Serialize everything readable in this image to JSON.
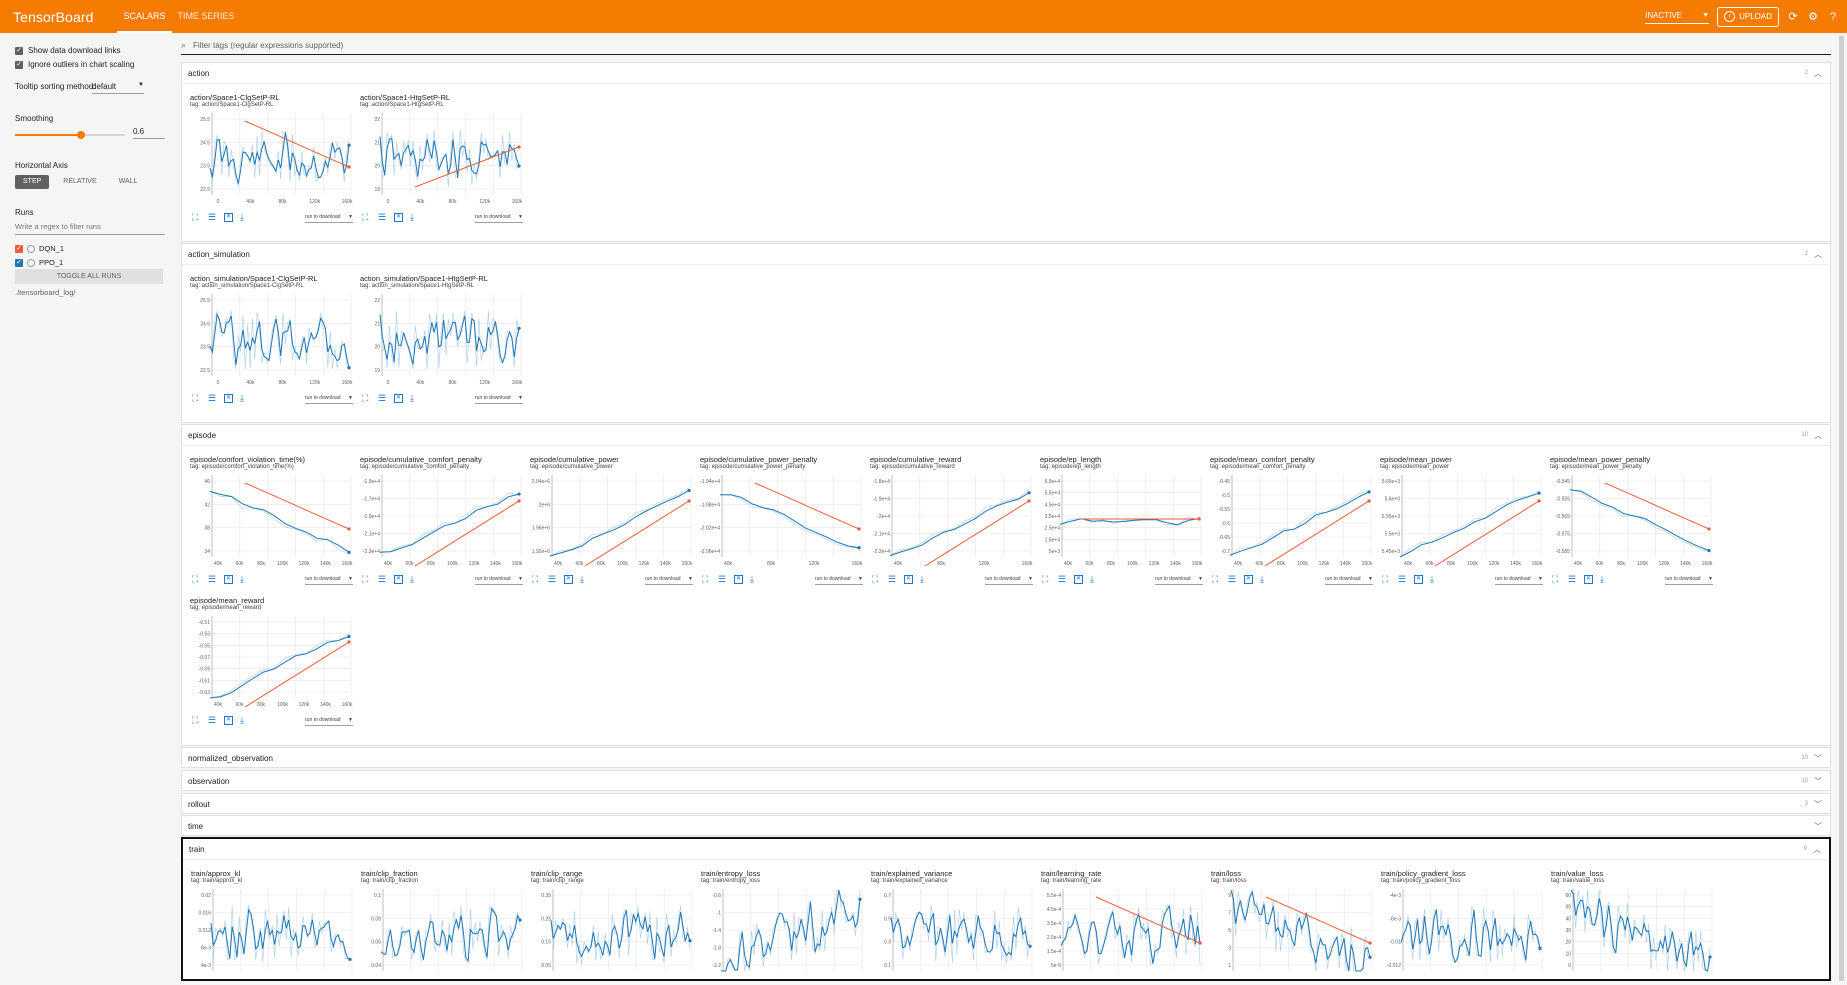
{
  "header": {
    "brand": "TensorBoard",
    "tabs": [
      {
        "label": "SCALARS",
        "active": true
      },
      {
        "label": "TIME SERIES",
        "active": false
      }
    ],
    "status_select": "INACTIVE",
    "upload_label": "UPLOAD"
  },
  "sidebar": {
    "show_download_links": "Show data download links",
    "ignore_outliers": "Ignore outliers in chart scaling",
    "tooltip_label": "Tooltip sorting method:",
    "tooltip_value": "default",
    "smoothing_label": "Smoothing",
    "smoothing_value": "0.6",
    "smoothing_fraction": 0.6,
    "horizontal_axis_label": "Horizontal Axis",
    "axis_options": [
      "STEP",
      "RELATIVE",
      "WALL"
    ],
    "runs_label": "Runs",
    "runs_filter_placeholder": "Write a regex to filter runs",
    "runs": [
      {
        "name": "DQN_1",
        "color": "#ef5b3a"
      },
      {
        "name": "PPO_1",
        "color": "#1f77b4"
      }
    ],
    "toggle_all_label": "TOGGLE ALL RUNS",
    "log_path": "./tensorboard_log/"
  },
  "main": {
    "filter_placeholder": "Filter tags (regular expressions supported)",
    "download_select": "run to download",
    "sections": [
      {
        "title": "action",
        "count": "2"
      },
      {
        "title": "action_simulation",
        "count": "2"
      },
      {
        "title": "episode",
        "count": "10"
      },
      {
        "title": "normalized_observation",
        "count": "10"
      },
      {
        "title": "observation",
        "count": "10"
      },
      {
        "title": "rollout",
        "count": "3"
      },
      {
        "title": "time",
        "count": ""
      },
      {
        "title": "train",
        "count": "9"
      }
    ],
    "cards": [
      {
        "title": "action/Space1-ClgSetP-RL",
        "tag": "tag: action/Space1-ClgSetP-RL",
        "yticks": [
          "25.5",
          "24.5",
          "23.5",
          "22.5"
        ],
        "xticks": [
          "0",
          "40k",
          "80k",
          "120k",
          "160k"
        ]
      },
      {
        "title": "action/Space1-HtgSetP-RL",
        "tag": "tag: action/Space1-HtgSetP-RL",
        "yticks": [
          "22",
          "21",
          "20",
          "19"
        ],
        "xticks": [
          "0",
          "40k",
          "80k",
          "120k",
          "160k"
        ]
      },
      {
        "title": "action_simulation/Space1-ClgSetP-RL",
        "tag": "tag: action_simulation/Space1-ClgSetP-RL",
        "yticks": [
          "25.5",
          "24.5",
          "23.5",
          "22.5"
        ],
        "xticks": [
          "0",
          "40k",
          "80k",
          "120k",
          "160k"
        ]
      },
      {
        "title": "action_simulation/Space1-HtgSetP-RL",
        "tag": "tag: action_simulation/Space1-HtgSetP-RL",
        "yticks": [
          "22",
          "21",
          "20",
          "19"
        ],
        "xticks": [
          "0",
          "40k",
          "80k",
          "120k",
          "160k"
        ]
      },
      {
        "title": "episode/comfort_violation_time(%)",
        "tag": "tag: episode/comfort_violation_time(%)",
        "yticks": [
          "46",
          "42",
          "38",
          "34"
        ],
        "xticks": [
          "40k",
          "60k",
          "80k",
          "100k",
          "120k",
          "140k",
          "160k"
        ]
      },
      {
        "title": "episode/cumulative_comfort_penalty",
        "tag": "tag: episode/cumulative_comfort_penalty",
        "yticks": [
          "-1.5e+4",
          "-1.7e+4",
          "-1.9e+4",
          "-2.1e+4",
          "-2.3e+4"
        ],
        "xticks": [
          "40k",
          "60k",
          "80k",
          "100k",
          "120k",
          "140k",
          "160k"
        ]
      },
      {
        "title": "episode/cumulative_power",
        "tag": "tag: episode/cumulative_power",
        "yticks": [
          "2.04e+6",
          "2e+6",
          "1.96e+6",
          "1.92e+6"
        ],
        "xticks": [
          "40k",
          "60k",
          "80k",
          "100k",
          "120k",
          "140k",
          "160k"
        ]
      },
      {
        "title": "episode/cumulative_power_penalty",
        "tag": "tag: episode/cumulative_power_penalty",
        "yticks": [
          "-1.94e+4",
          "-1.98e+4",
          "-2.02e+4",
          "-2.06e+4"
        ],
        "xticks": [
          "40k",
          "80k",
          "120k",
          "160k"
        ]
      },
      {
        "title": "episode/cumulative_reward",
        "tag": "tag: episode/cumulative_reward",
        "yticks": [
          "-1.8e+4",
          "-1.9e+4",
          "-2e+4",
          "-2.1e+4",
          "-2.2e+4"
        ],
        "xticks": [
          "40k",
          "80k",
          "120k",
          "160k"
        ]
      },
      {
        "title": "episode/ep_length",
        "tag": "tag: episode/ep_length",
        "yticks": [
          "6.5e+4",
          "5.5e+4",
          "4.5e+4",
          "3.5e+4",
          "2.5e+4",
          "1.5e+4",
          "5e+3"
        ],
        "xticks": [
          "40k",
          "60k",
          "80k",
          "100k",
          "120k",
          "140k",
          "160k"
        ]
      },
      {
        "title": "episode/mean_comfort_penalty",
        "tag": "tag: episode/mean_comfort_penalty",
        "yticks": [
          "-0.45",
          "-0.5",
          "-0.55",
          "-0.6",
          "-0.65",
          "-0.7"
        ],
        "xticks": [
          "40k",
          "60k",
          "80k",
          "100k",
          "120k",
          "140k",
          "160k"
        ]
      },
      {
        "title": "episode/mean_power",
        "tag": "tag: episode/mean_power",
        "yticks": [
          "5.65e+3",
          "5.6e+3",
          "5.55e+3",
          "5.5e+3",
          "5.45e+3"
        ],
        "xticks": [
          "40k",
          "60k",
          "80k",
          "100k",
          "120k",
          "140k",
          "160k"
        ]
      },
      {
        "title": "episode/mean_power_penalty",
        "tag": "tag: episode/mean_power_penalty",
        "yticks": [
          "-0.545",
          "-0.555",
          "-0.565",
          "-0.575",
          "-0.585"
        ],
        "xticks": [
          "40k",
          "60k",
          "80k",
          "100k",
          "120k",
          "140k",
          "160k"
        ]
      },
      {
        "title": "episode/mean_reward",
        "tag": "tag: episode/mean_reward",
        "yticks": [
          "-0.51",
          "-0.53",
          "-0.55",
          "-0.57",
          "-0.59",
          "-0.61",
          "-0.63"
        ],
        "xticks": [
          "40k",
          "60k",
          "80k",
          "100k",
          "120k",
          "140k",
          "160k"
        ]
      },
      {
        "title": "train/approx_kl",
        "tag": "tag: train/approx_kl",
        "yticks": [
          "0.02",
          "0.016",
          "0.012",
          "8e-3",
          "4e-3"
        ],
        "xticks": []
      },
      {
        "title": "train/clip_fraction",
        "tag": "tag: train/clip_fraction",
        "yticks": [
          "0.1",
          "0.08",
          "0.06",
          "0.04"
        ],
        "xticks": []
      },
      {
        "title": "train/clip_range",
        "tag": "tag: train/clip_range",
        "yticks": [
          "0.35",
          "0.25",
          "0.15",
          "0.05"
        ],
        "xticks": []
      },
      {
        "title": "train/entropy_loss",
        "tag": "tag: train/entropy_loss",
        "yticks": [
          "-0.6",
          "-1",
          "-1.4",
          "-1.8",
          "-2.2"
        ],
        "xticks": []
      },
      {
        "title": "train/explained_variance",
        "tag": "tag: train/explained_variance",
        "yticks": [
          "0.7",
          "0.5",
          "0.3",
          "0.1"
        ],
        "xticks": []
      },
      {
        "title": "train/learning_rate",
        "tag": "tag: train/learning_rate",
        "yticks": [
          "5.5e-4",
          "4.5e-4",
          "3.5e-4",
          "2.5e-4",
          "1.5e-4",
          "5e-5"
        ],
        "xticks": []
      },
      {
        "title": "train/loss",
        "tag": "tag: train/loss",
        "yticks": [
          "9",
          "7",
          "5",
          "3",
          "1"
        ],
        "xticks": []
      },
      {
        "title": "train/policy_gradient_loss",
        "tag": "tag: train/policy_gradient_loss",
        "yticks": [
          "-4e-3",
          "-8e-3",
          "-0.01",
          "-0.012"
        ],
        "xticks": []
      },
      {
        "title": "train/value_loss",
        "tag": "tag: train/value_loss",
        "yticks": [
          "60",
          "50",
          "40",
          "30",
          "20",
          "10",
          "0"
        ],
        "xticks": []
      }
    ]
  }
}
